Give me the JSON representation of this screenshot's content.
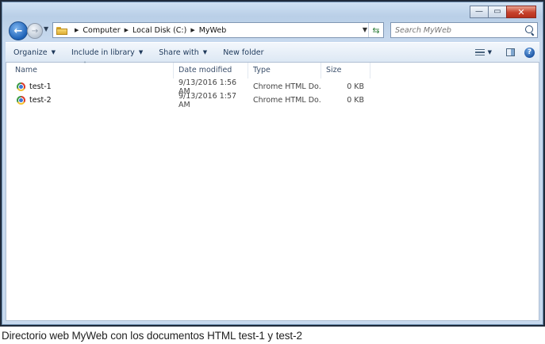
{
  "window": {
    "caption_buttons": {
      "minimize": "—",
      "maximize": "▭",
      "close": "✕"
    }
  },
  "address_bar": {
    "crumbs": [
      "Computer",
      "Local Disk (C:)",
      "MyWeb"
    ],
    "search_placeholder": "Search MyWeb"
  },
  "toolbar": {
    "organize": "Organize",
    "include_in_library": "Include in library",
    "share_with": "Share with",
    "new_folder": "New folder"
  },
  "columns": {
    "name": "Name",
    "date_modified": "Date modified",
    "type": "Type",
    "size": "Size"
  },
  "files": [
    {
      "name": "test-1",
      "date": "9/13/2016 1:56 AM",
      "type": "Chrome HTML Do...",
      "size": "0 KB"
    },
    {
      "name": "test-2",
      "date": "9/13/2016 1:57 AM",
      "type": "Chrome HTML Do...",
      "size": "0 KB"
    }
  ],
  "figure_caption": "Directorio web MyWeb con los documentos HTML test-1 y test-2",
  "icons": {
    "back": "back-arrow-icon",
    "forward": "forward-arrow-icon",
    "folder": "folder-icon",
    "refresh": "refresh-icon",
    "search": "search-icon",
    "views": "views-icon",
    "preview_pane": "preview-pane-icon",
    "help": "help-icon",
    "file": "chrome-html-icon"
  }
}
